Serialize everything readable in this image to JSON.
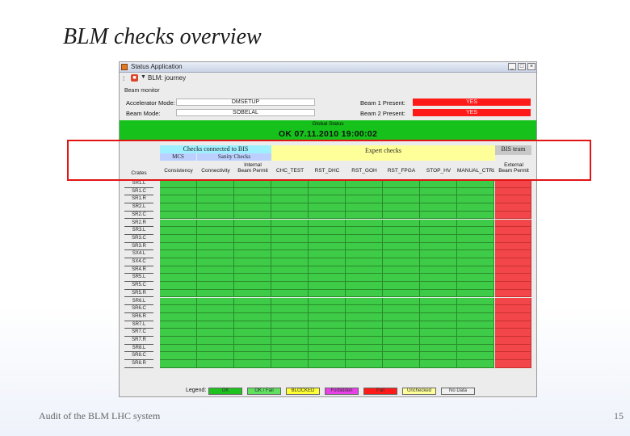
{
  "slide": {
    "title": "BLM checks overview",
    "footer_left": "Audit of the BLM LHC system",
    "page_number": "15"
  },
  "window": {
    "title": "Status Application",
    "buttons": [
      "_",
      "□",
      "×"
    ],
    "toolbar_label": "BLM: journey"
  },
  "beam_monitor": {
    "section": "Beam monitor",
    "accelerator_mode_label": "Accelerator Mode:",
    "accelerator_mode_value": "DMSETUP",
    "beam_mode_label": "Beam Mode:",
    "beam_mode_value": "SOBELAL",
    "beam1_label": "Beam 1 Present:",
    "beam1_value": "YES",
    "beam2_label": "Beam 2 Present:",
    "beam2_value": "YES"
  },
  "global_status": {
    "label": "Global Status",
    "message": "OK 07.11.2010 19:00:02",
    "color": "#15c11a"
  },
  "groups": {
    "checks_connected": "Checks connected to BIS",
    "mcs": "MCS",
    "sanity": "Sanity Checks",
    "expert": "Expert checks",
    "bis_team": "BIS team"
  },
  "columns": {
    "crates": "Crates",
    "headers": [
      {
        "line1": "",
        "line2": "Consistency"
      },
      {
        "line1": "",
        "line2": "Connectivity"
      },
      {
        "line1": "Internal",
        "line2": "Beam Permit"
      },
      {
        "line1": "",
        "line2": "CHC_TEST"
      },
      {
        "line1": "",
        "line2": "RST_DHC"
      },
      {
        "line1": "",
        "line2": "RST_GOH"
      },
      {
        "line1": "",
        "line2": "RST_FPGA"
      },
      {
        "line1": "",
        "line2": "STOP_HV"
      },
      {
        "line1": "",
        "line2": "MANUAL_CTRL"
      },
      {
        "line1": "External",
        "line2": "Beam Permit"
      }
    ]
  },
  "crates": [
    "SR1.L",
    "SR1.C",
    "SR1.R",
    "SR2.L",
    "SR2.C",
    "SR2.R",
    "SR3.L",
    "SR3.C",
    "SR3.R",
    "SX4.L",
    "SX4.C",
    "SR4.R",
    "SR5.L",
    "SR5.C",
    "SR5.R",
    "SR6.L",
    "SR6.C",
    "SR6.R",
    "SR7.L",
    "SR7.C",
    "SR7.R",
    "SR8.L",
    "SR8.C",
    "SR8.R"
  ],
  "cell_colors": {
    "ok": "#3ecb48",
    "external": "#f2464a"
  },
  "legend": {
    "label": "Legend:",
    "items": [
      {
        "text": "OK",
        "color": "#1ec21e"
      },
      {
        "text": "OK / Fail",
        "color": "#5fe05f"
      },
      {
        "text": "BLOCKED",
        "color": "#ffff33"
      },
      {
        "text": "Forbidden",
        "color": "#e640e6"
      },
      {
        "text": "Fail",
        "color": "#ff1a1a"
      },
      {
        "text": "Unchecked",
        "color": "#ffff99"
      },
      {
        "text": "No Data",
        "color": "#f0f0f0"
      }
    ]
  }
}
